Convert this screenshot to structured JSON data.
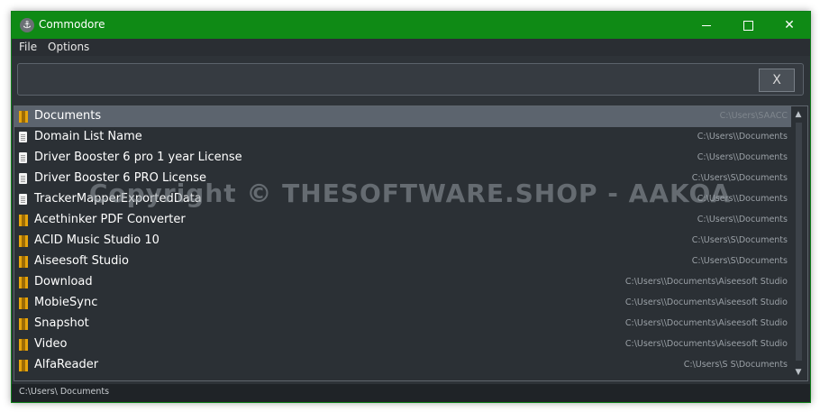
{
  "window": {
    "title": "Commodore",
    "minimize": "",
    "maximize": "",
    "close": "✕"
  },
  "menu": {
    "file": "File",
    "options": "Options"
  },
  "search": {
    "value": "",
    "clear_label": "X"
  },
  "results": [
    {
      "type": "folder",
      "name": "Documents",
      "path": "C:\\Users\\SAACC"
    },
    {
      "type": "file",
      "name": "Domain List Name",
      "path": "C:\\Users\\\\Documents"
    },
    {
      "type": "file",
      "name": "Driver Booster 6 pro 1 year  License",
      "path": "C:\\Users\\\\Documents"
    },
    {
      "type": "file",
      "name": "Driver Booster 6 PRO License",
      "path": "C:\\Users\\S\\Documents"
    },
    {
      "type": "file",
      "name": "TrackerMapperExportedData",
      "path": "C:\\Users\\\\Documents"
    },
    {
      "type": "folder",
      "name": "Acethinker PDF Converter",
      "path": "C:\\Users\\\\Documents"
    },
    {
      "type": "folder",
      "name": "ACID Music Studio 10",
      "path": "C:\\Users\\S\\Documents"
    },
    {
      "type": "folder",
      "name": "Aiseesoft Studio",
      "path": "C:\\Users\\S\\Documents"
    },
    {
      "type": "folder",
      "name": "Download",
      "path": "C:\\Users\\\\Documents\\Aiseesoft Studio"
    },
    {
      "type": "folder",
      "name": "MobieSync",
      "path": "C:\\Users\\\\Documents\\Aiseesoft Studio"
    },
    {
      "type": "folder",
      "name": "Snapshot",
      "path": "C:\\Users\\\\Documents\\Aiseesoft Studio"
    },
    {
      "type": "folder",
      "name": "Video",
      "path": "C:\\Users\\\\Documents\\Aiseesoft Studio"
    },
    {
      "type": "folder",
      "name": "AlfaReader",
      "path": "C:\\Users\\S S\\Documents"
    }
  ],
  "status": {
    "text": "C:\\Users\\ Documents"
  },
  "watermark": "Copyright ©  THESOFTWARE.SHOP - AAKOA",
  "colors": {
    "titlebar": "#0f8a15",
    "background": "#2e3338",
    "selected_row": "#5c646e",
    "folder": "#e6a40c"
  }
}
